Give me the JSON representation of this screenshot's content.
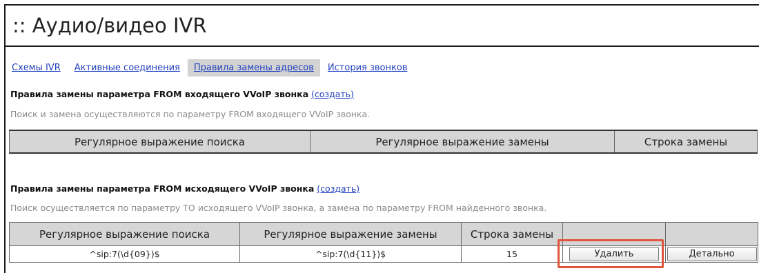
{
  "page": {
    "title": ":: Аудио/видео IVR"
  },
  "tabs": [
    {
      "label": "Схемы IVR",
      "active": false
    },
    {
      "label": "Активные соединения",
      "active": false
    },
    {
      "label": "Правила замены адресов",
      "active": true
    },
    {
      "label": "История звонков",
      "active": false
    }
  ],
  "incoming": {
    "title": "Правила замены параметра FROM входящего VVoIP звонка",
    "create_link": "(создать)",
    "description": "Поиск и замена осуществляются по параметру FROM входящего VVoIP звонка.",
    "columns": [
      "Регулярное выражение поиска",
      "Регулярное выражение замены",
      "Строка замены"
    ]
  },
  "outgoing": {
    "title": "Правила замены параметра FROM исходящего VVoIP звонка",
    "create_link": "(создать)",
    "description": "Поиск осуществляется по параметру TO исходящего VVoIP звонка, а замена по параметру FROM найденного звонка.",
    "columns": [
      "Регулярное выражение поиска",
      "Регулярное выражение замены",
      "Строка замены",
      "",
      ""
    ],
    "rows": [
      {
        "search": "^sip:7(\\d{09})$",
        "replace": "^sip:7(\\d{11})$",
        "string": "15",
        "delete_label": "Удалить",
        "details_label": "Детально"
      }
    ]
  },
  "colors": {
    "link": "#1f3fbf",
    "header_bg": "#d6d6d6",
    "active_tab_bg": "#d3d3d3",
    "highlight": "#e0553c"
  }
}
